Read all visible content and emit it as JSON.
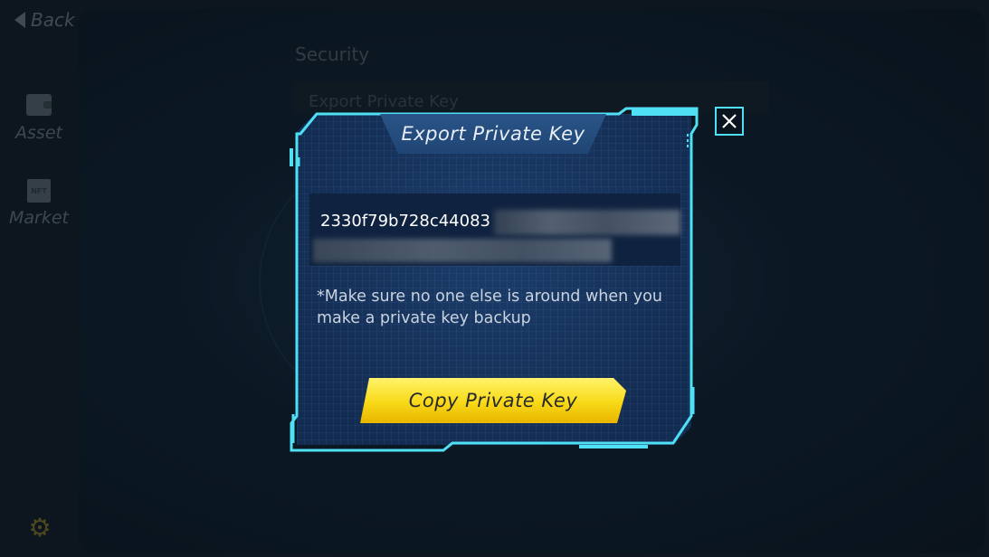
{
  "nav": {
    "back_label": "Back",
    "items": [
      {
        "label": "Asset",
        "icon": "wallet-icon"
      },
      {
        "label": "Market",
        "icon": "nft-icon",
        "icon_text": "NFT"
      }
    ],
    "settings_icon": "gear-icon"
  },
  "page": {
    "section_title": "Security",
    "export_row_label": "Export Private Key"
  },
  "modal": {
    "title": "Export Private Key",
    "private_key_visible": "2330f79b728c44083",
    "warning": "*Make sure no one else is around when you make a private key backup",
    "copy_button_label": "Copy Private Key",
    "close_icon": "close-icon"
  },
  "colors": {
    "frame_cyan": "#4fe0f5",
    "button_yellow": "#f8d916",
    "modal_blue": "#17345e"
  }
}
